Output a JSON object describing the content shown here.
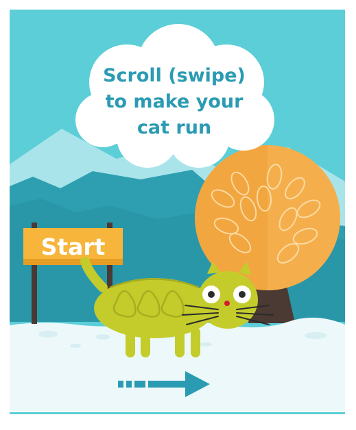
{
  "instruction": {
    "line1": "Scroll (swipe)",
    "line2": "to make your",
    "line3": "cat run"
  },
  "sign": {
    "label": "Start"
  },
  "colors": {
    "sky": "#5cced8",
    "mountain_far": "#a9e4ea",
    "mountain_near": "#2e9fb0",
    "snow": "#ecf8fa",
    "cloud": "#ffffff",
    "text_accent": "#2b9bb3",
    "sign": "#f7b53b",
    "sign_post": "#4a3a33",
    "tree_crown": "#f2a63f",
    "tree_trunk": "#4a3a33",
    "cat": "#c4cc2b",
    "arrow": "#2b9bb3"
  },
  "icons": {
    "cat": "cat-character",
    "arrow": "arrow-right-icon",
    "tree": "autumn-tree",
    "cloud": "speech-cloud"
  }
}
